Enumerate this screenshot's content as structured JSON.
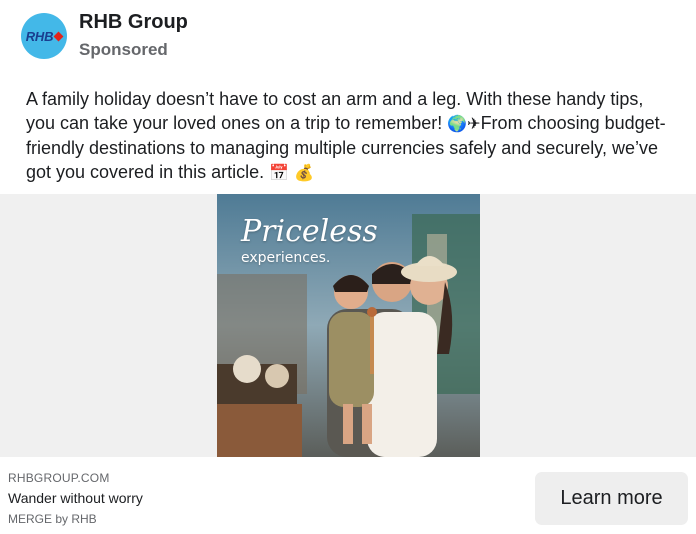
{
  "post": {
    "page_name": "RHB Group",
    "sponsored_label": "Sponsored",
    "avatar_text": "RHB",
    "body_line1": "A family holiday doesn’t have to cost an arm and a leg. With these handy tips,",
    "body_line2": "you can take your loved ones on a trip to remember! ",
    "body_line2b": "From choosing budget-",
    "body_line3": "friendly destinations to managing multiple currencies safely and securely, we’ve",
    "body_line4": "got you covered in this article. ",
    "emoji_globe": "🌍",
    "emoji_plane": "✈",
    "emoji_calendar": "📅",
    "emoji_moneybag": "💰"
  },
  "media": {
    "overlay_title": "Priceless",
    "overlay_subtitle": "experiences."
  },
  "link": {
    "domain": "RHBGROUP.COM",
    "headline": "Wander without worry",
    "description": "MERGE by RHB",
    "cta_label": "Learn more"
  },
  "colors": {
    "avatar_bg": "#43b8e8",
    "brand_blue": "#1a3e8f",
    "brand_red": "#e2231a",
    "cta_bg": "#eeeeee"
  }
}
